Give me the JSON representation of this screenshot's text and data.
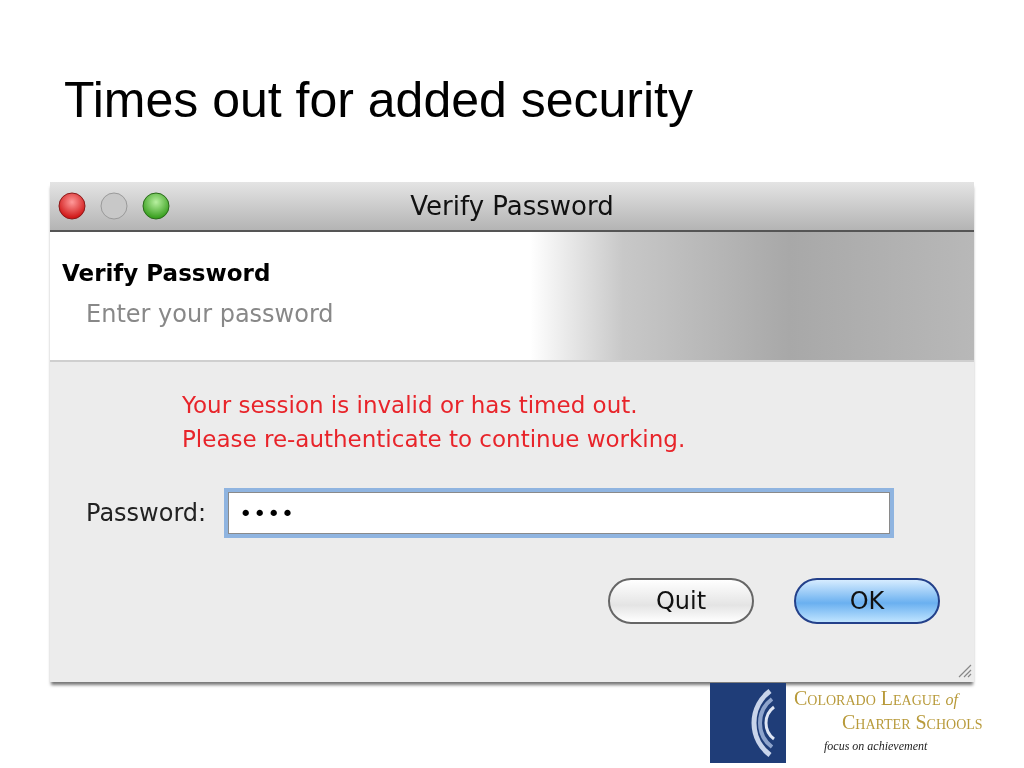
{
  "slide_title": "Times out for added security",
  "window": {
    "title": "Verify Password"
  },
  "header": {
    "title": "Verify Password",
    "subtitle": "Enter your password"
  },
  "message": [
    "Your session is invalid or has timed out.",
    "Please re-authenticate to continue working."
  ],
  "password": {
    "label": "Password:",
    "value": "••••",
    "focused": true
  },
  "buttons": [
    {
      "label": "Quit",
      "default": false
    },
    {
      "label": "OK",
      "default": true
    }
  ],
  "logo": {
    "line1": "Colorado League",
    "of": "of",
    "line2": "Charter Schools",
    "tagline": "focus on achievement"
  }
}
